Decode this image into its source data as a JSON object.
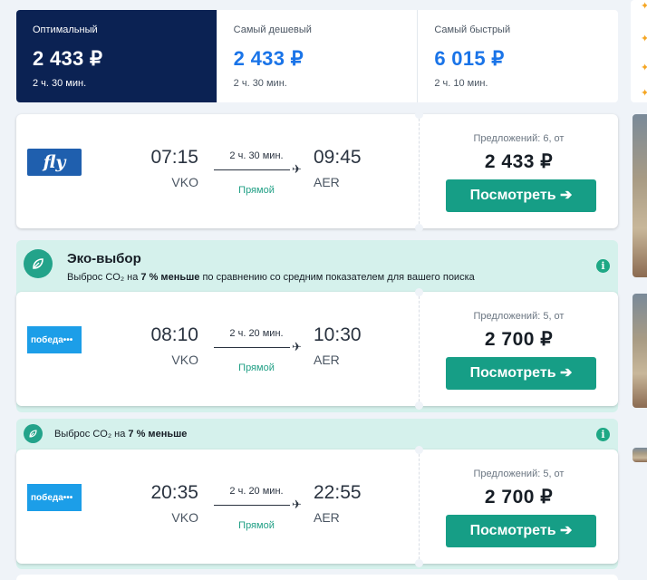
{
  "sort_tabs": [
    {
      "label": "Оптимальный",
      "price": "2 433 ₽",
      "duration": "2 ч. 30 мин.",
      "active": true
    },
    {
      "label": "Самый дешевый",
      "price": "2 433 ₽",
      "duration": "2 ч. 30 мин.",
      "active": false
    },
    {
      "label": "Самый быстрый",
      "price": "6 015 ₽",
      "duration": "2 ч. 10 мин.",
      "active": false
    }
  ],
  "eco": {
    "title": "Эко-выбор",
    "subtitle_prefix": "Выброс CO₂ на ",
    "subtitle_bold": "7 % меньше",
    "subtitle_suffix": " по сравнению со средним показателем для вашего поиска",
    "small_prefix": "Выброс CO₂ на ",
    "small_bold": "7 % меньше",
    "info_icon": "i"
  },
  "flights": [
    {
      "airline": "ifly",
      "logo_text": "fly",
      "dep_time": "07:15",
      "dep_code": "VKO",
      "arr_time": "09:45",
      "arr_code": "AER",
      "duration": "2 ч. 30 мин.",
      "stops": "Прямой",
      "offers": "Предложений: 6, от",
      "price": "2 433 ₽",
      "button": "Посмотреть ➔"
    },
    {
      "airline": "pobeda",
      "logo_text": "победа•••",
      "dep_time": "08:10",
      "dep_code": "VKO",
      "arr_time": "10:30",
      "arr_code": "AER",
      "duration": "2 ч. 20 мин.",
      "stops": "Прямой",
      "offers": "Предложений: 5, от",
      "price": "2 700 ₽",
      "button": "Посмотреть ➔"
    },
    {
      "airline": "pobeda",
      "logo_text": "победа•••",
      "dep_time": "20:35",
      "dep_code": "VKO",
      "arr_time": "22:55",
      "arr_code": "AER",
      "duration": "2 ч. 20 мин.",
      "stops": "Прямой",
      "offers": "Предложений: 5, от",
      "price": "2 700 ₽",
      "button": "Посмотреть ➔"
    }
  ],
  "colors": {
    "accent": "#169e86",
    "active_tab": "#0b2253",
    "price_blue": "#1a74e8",
    "eco_bg": "#d5f1ec"
  }
}
